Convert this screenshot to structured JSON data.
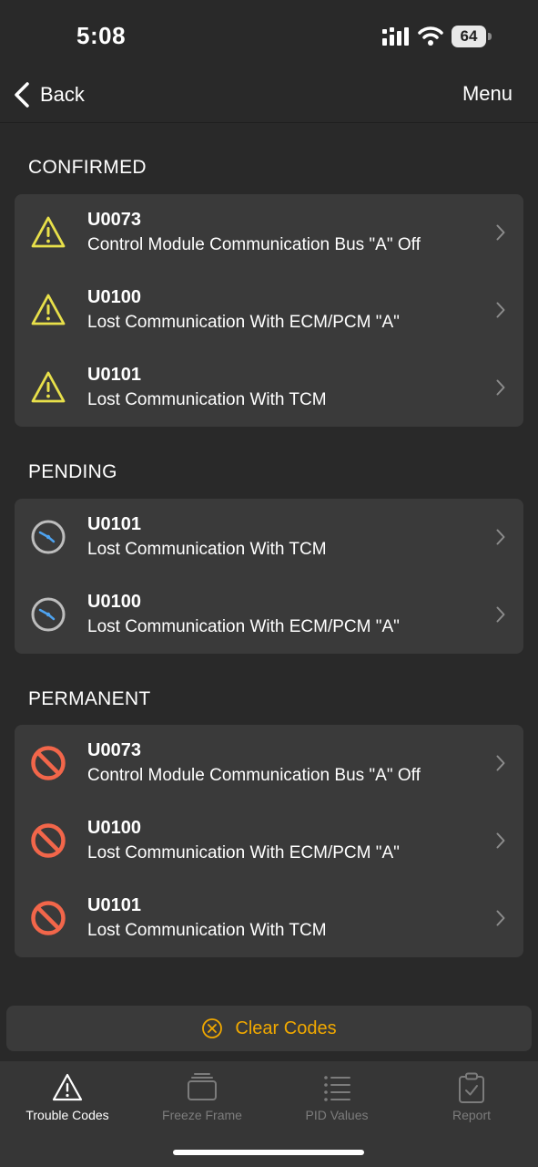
{
  "status_bar": {
    "time": "5:08",
    "battery": "64"
  },
  "nav": {
    "back_label": "Back",
    "menu_label": "Menu"
  },
  "sections": {
    "confirmed": {
      "title": "CONFIRMED",
      "icon": "warning-icon",
      "items": [
        {
          "code": "U0073",
          "description": "Control Module Communication Bus \"A\" Off"
        },
        {
          "code": "U0100",
          "description": "Lost Communication With ECM/PCM \"A\""
        },
        {
          "code": "U0101",
          "description": "Lost Communication With TCM"
        }
      ]
    },
    "pending": {
      "title": "PENDING",
      "icon": "clock-icon",
      "items": [
        {
          "code": "U0101",
          "description": "Lost Communication With TCM"
        },
        {
          "code": "U0100",
          "description": "Lost Communication With ECM/PCM \"A\""
        }
      ]
    },
    "permanent": {
      "title": "PERMANENT",
      "icon": "prohibited-icon",
      "items": [
        {
          "code": "U0073",
          "description": "Control Module Communication Bus \"A\" Off"
        },
        {
          "code": "U0100",
          "description": "Lost Communication With ECM/PCM \"A\""
        },
        {
          "code": "U0101",
          "description": "Lost Communication With TCM"
        }
      ]
    }
  },
  "clear_codes": {
    "label": "Clear Codes"
  },
  "tabs": [
    {
      "label": "Trouble Codes",
      "icon": "warning-icon",
      "active": true
    },
    {
      "label": "Freeze Frame",
      "icon": "layers-icon",
      "active": false
    },
    {
      "label": "PID Values",
      "icon": "list-icon",
      "active": false
    },
    {
      "label": "Report",
      "icon": "clipboard-icon",
      "active": false
    }
  ],
  "colors": {
    "background": "#292929",
    "card": "#3a3a3a",
    "warning": "#e8e04a",
    "pending_clock_hand": "#4ea3f0",
    "prohibited": "#f2664a",
    "accent": "#f0a800",
    "tab_inactive": "#7c7c7c"
  }
}
